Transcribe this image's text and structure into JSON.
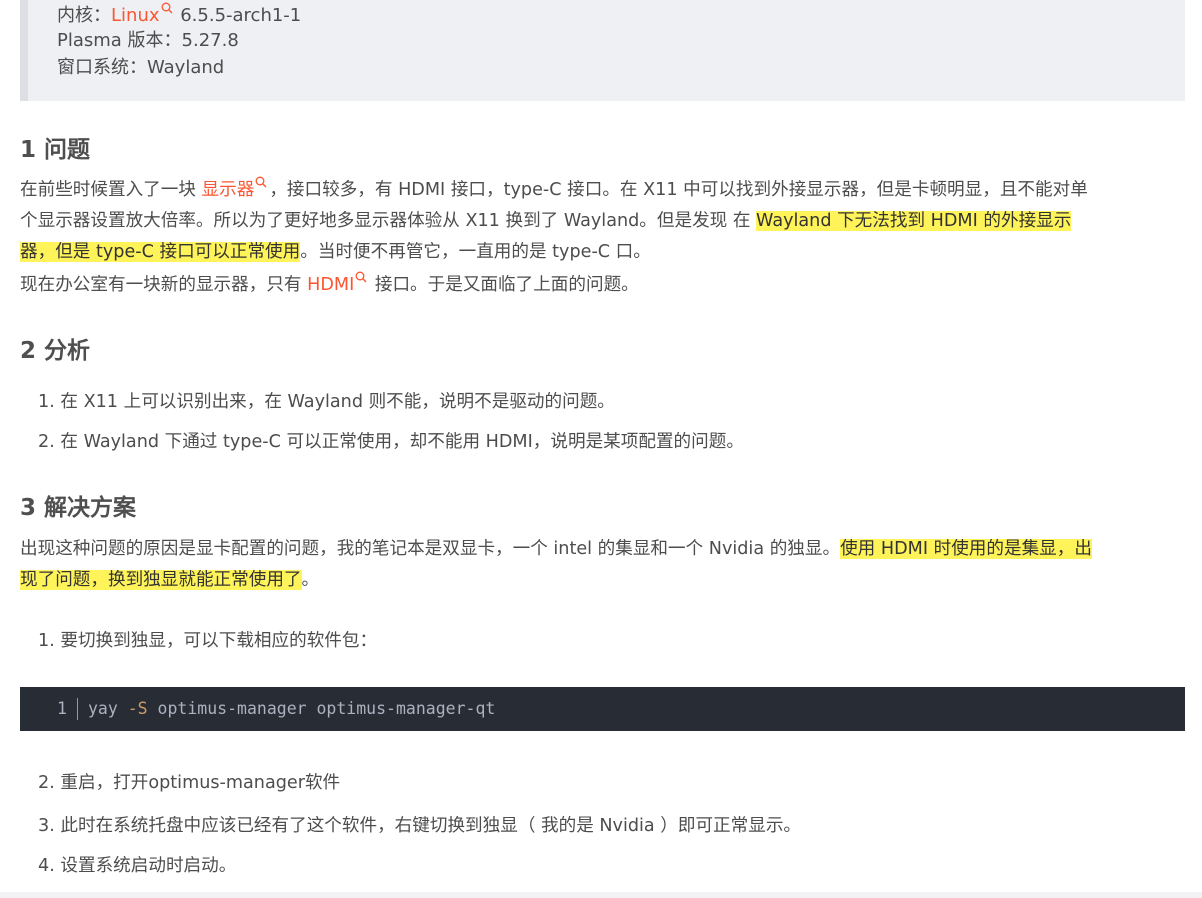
{
  "sysinfo": {
    "kernel_label": "内核：",
    "kernel_link": "Linux",
    "kernel_version": " 6.5.5-arch1-1",
    "plasma": "Plasma 版本：5.27.8",
    "window_system": "窗口系统：Wayland"
  },
  "sections": {
    "problem": {
      "heading": "1 问题",
      "p1_row1_a": "在前些时候置入了一块 ",
      "p1_link": "显示器",
      "p1_row1_b": "，接口较多，有 HDMI 接口，type-C 接口。在 X11 中可以找到外接显示器，但是卡顿明显，且不能对单",
      "p1_row2_a": "个显示器设置放大倍率。所以为了更好地多显示器体验从 X11 换到了 Wayland。但是发现 在 ",
      "p1_row2_mark": "Wayland 下无法找到 HDMI 的外接显示",
      "p1_row3_mark": "器，但是 type-C 接口可以正常使用",
      "p1_row3_b": "。当时便不再管它，一直用的是 type-C 口。",
      "p2_a": "现在办公室有一块新的显示器，只有 ",
      "p2_link": "HDMI",
      "p2_b": " 接口。于是又面临了上面的问题。"
    },
    "analysis": {
      "heading": "2 分析",
      "items": [
        "1. 在 X11 上可以识别出来，在 Wayland 则不能，说明不是驱动的问题。",
        "2. 在 Wayland 下通过 type-C 可以正常使用，却不能用 HDMI，说明是某项配置的问题。"
      ]
    },
    "solution": {
      "heading": "3 解决方案",
      "p_row1_a": "出现这种问题的原因是显卡配置的问题，我的笔记本是双显卡，一个 intel 的集显和一个 Nvidia 的独显。",
      "p_row1_mark": "使用 HDMI 时使用的是集显，出",
      "p_row2_mark": "现了问题，换到独显就能正常使用了",
      "p_row2_b": "。",
      "step1": "1. 要切换到独显，可以下载相应的软件包：",
      "code": {
        "line_number": "1",
        "cmd": "yay ",
        "flag": "-S",
        "args": " optimus-manager optimus-manager-qt"
      },
      "steps_after": [
        "2. 重启，打开optimus-manager软件",
        "3. 此时在系统托盘中应该已经有了这个软件，右键切换到独显（ 我的是 Nvidia ）即可正常显示。",
        "4. 设置系统启动时启动。"
      ]
    }
  },
  "colors": {
    "link": "#fc5531",
    "highlight": "#fff35a",
    "code_bg": "#282c34",
    "blockquote_bg": "#eef0f4"
  }
}
